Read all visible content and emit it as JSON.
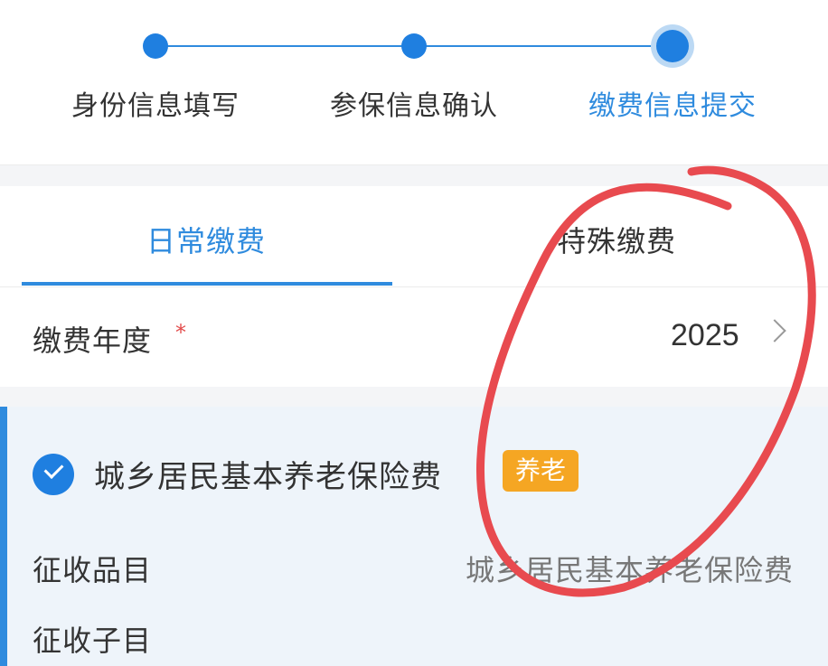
{
  "stepper": {
    "steps": [
      {
        "label": "身份信息填写",
        "state": "done"
      },
      {
        "label": "参保信息确认",
        "state": "done"
      },
      {
        "label": "缴费信息提交",
        "state": "current"
      }
    ]
  },
  "tabs": {
    "items": [
      {
        "label": "日常缴费",
        "active": true
      },
      {
        "label": "特殊缴费",
        "active": false
      }
    ]
  },
  "year_row": {
    "label": "缴费年度",
    "required_mark": "*",
    "value": "2025"
  },
  "insurance_card": {
    "title": "城乡居民基本养老保险费",
    "badge": "养老",
    "checked": true,
    "fields": [
      {
        "label": "征收品目",
        "value": "城乡居民基本养老保险费"
      },
      {
        "label": "征收子目",
        "value": ""
      }
    ]
  },
  "colors": {
    "accent": "#2f8bde",
    "badge": "#f5a623",
    "annotation": "#e84a4f",
    "required": "#e24b4b"
  },
  "icons": [
    "step-dot",
    "chevron-right-icon",
    "check-circle-icon"
  ]
}
